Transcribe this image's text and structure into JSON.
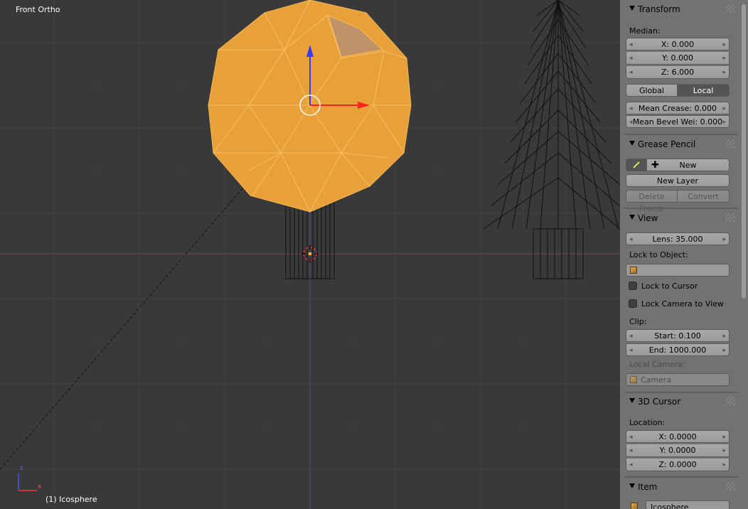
{
  "viewport": {
    "view_label": "Front Ortho",
    "object_label": "(1) Icosphere",
    "axis_z": "z",
    "axis_x": "x"
  },
  "panel": {
    "transform": {
      "title": "Transform",
      "median_label": "Median:",
      "x": "X: 0.000",
      "y": "Y: 0.000",
      "z": "Z: 6.000",
      "global": "Global",
      "local": "Local",
      "mean_crease": "Mean Crease: 0.000",
      "mean_bevel": "Mean Bevel Wei: 0.000"
    },
    "grease_pencil": {
      "title": "Grease Pencil",
      "new": "New",
      "new_layer": "New Layer",
      "delete_frame": "Delete Frame",
      "convert": "Convert"
    },
    "view": {
      "title": "View",
      "lens": "Lens: 35.000",
      "lock_to_object": "Lock to Object:",
      "lock_to_cursor": "Lock to Cursor",
      "lock_camera": "Lock Camera to View",
      "clip": "Clip:",
      "start": "Start: 0.100",
      "end": "End: 1000.000",
      "local_camera": "Local Camera:",
      "camera": "Camera"
    },
    "cursor": {
      "title": "3D Cursor",
      "location": "Location:",
      "x": "X: 0.0000",
      "y": "Y: 0.0000",
      "z": "Z: 0.0000"
    },
    "item": {
      "title": "Item",
      "name": "Icosphere"
    }
  }
}
